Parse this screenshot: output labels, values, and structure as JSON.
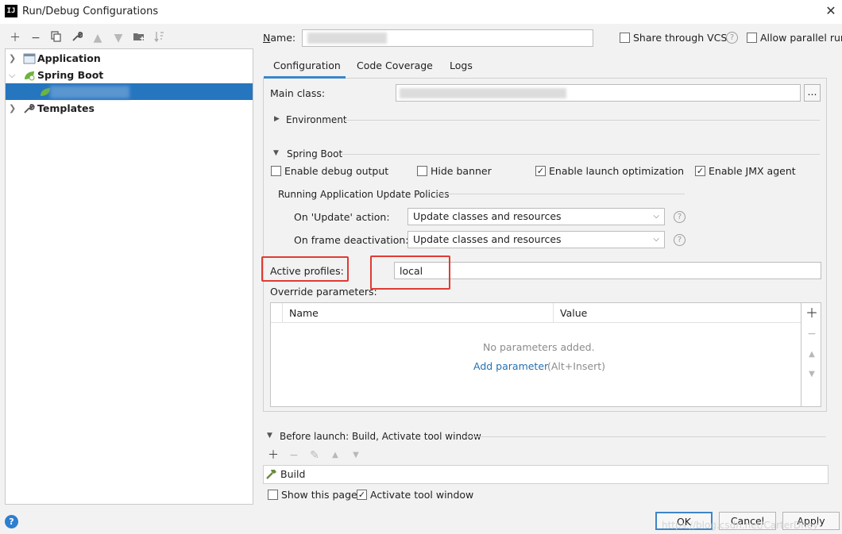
{
  "window": {
    "title": "Run/Debug Configurations",
    "app_icon": "IJ"
  },
  "toolbar": {
    "icons": [
      "add-icon",
      "remove-icon",
      "copy-icon",
      "wrench-icon",
      "move-up-icon",
      "move-down-icon",
      "folder-add-icon",
      "sort-icon"
    ]
  },
  "tree": {
    "items": [
      {
        "label": "Application",
        "icon": "application-icon",
        "expanded": false
      },
      {
        "label": "Spring Boot",
        "icon": "spring-boot-icon",
        "expanded": true
      },
      {
        "label": "",
        "icon": "spring-boot-icon",
        "selected": true
      },
      {
        "label": "Templates",
        "icon": "wrench-icon",
        "expanded": false
      }
    ]
  },
  "header": {
    "name_label": "Name:",
    "name_value": "",
    "share_vcs": {
      "label": "Share through VCS",
      "checked": false
    },
    "allow_parallel": {
      "label": "Allow parallel run",
      "checked": false
    }
  },
  "tabs": [
    {
      "label": "Configuration",
      "active": true
    },
    {
      "label": "Code Coverage",
      "active": false
    },
    {
      "label": "Logs",
      "active": false
    }
  ],
  "config": {
    "main_class_label": "Main class:",
    "main_class_value": "",
    "browse_label": "...",
    "environment_label": "Environment",
    "spring_boot_section": "Spring Boot",
    "checkboxes": [
      {
        "label": "Enable debug output",
        "checked": false
      },
      {
        "label": "Hide banner",
        "checked": false
      },
      {
        "label": "Enable launch optimization",
        "checked": true
      },
      {
        "label": "Enable JMX agent",
        "checked": true
      }
    ],
    "update_policies_label": "Running Application Update Policies",
    "update_action_label": "On 'Update' action:",
    "update_action_value": "Update classes and resources",
    "frame_deactivation_label": "On frame deactivation:",
    "frame_deactivation_value": "Update classes and resources",
    "active_profiles_label": "Active profiles:",
    "active_profiles_value": "local",
    "override_label": "Override parameters:",
    "table_headers": [
      "Name",
      "Value"
    ],
    "empty_text": "No parameters added.",
    "add_parameter_link": "Add parameter",
    "add_parameter_hint": "(Alt+Insert)"
  },
  "before_launch": {
    "label": "Before launch: Build, Activate tool window",
    "tasks": [
      "Build"
    ],
    "show_page": {
      "label": "Show this page",
      "checked": false
    },
    "activate_tool": {
      "label": "Activate tool window",
      "checked": true
    }
  },
  "buttons": {
    "ok": "OK",
    "cancel": "Cancel",
    "apply": "Apply"
  },
  "watermark": "https://blog.csdn.net/CarterDhey",
  "colors": {
    "selection": "#2675bf",
    "highlight_box": "#e03b32",
    "link": "#2470b3"
  }
}
